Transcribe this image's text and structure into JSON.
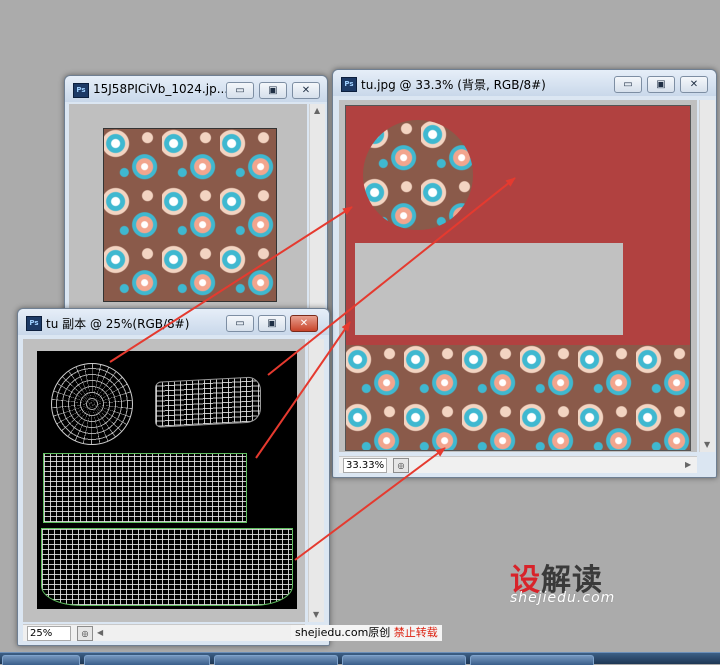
{
  "window_back": {
    "title": "15J58PICiVb_1024.jp...",
    "app_icon": "Ps"
  },
  "window_tu": {
    "title": "tu.jpg @ 33.3% (背景, RGB/8#)",
    "app_icon": "Ps",
    "zoom": "33.33%"
  },
  "window_copy": {
    "title": "tu 副本 @ 25%(RGB/8#)",
    "app_icon": "Ps",
    "zoom": "25%"
  },
  "controls": {
    "minimize_glyph": "▭",
    "maximize_glyph": "▣",
    "close_glyph": "✕",
    "nav_glyph": "◎",
    "arrow_left": "◀",
    "arrow_right": "▶",
    "arrow_up": "▲",
    "arrow_down": "▼"
  },
  "watermark": {
    "logo_part1": "设",
    "logo_part2": "解读",
    "url": "shejiedu.com",
    "footer_site": "shejiedu.com原创",
    "footer_notice": "禁止转载"
  },
  "colors": {
    "canvas_red": "#b14140",
    "arrow_red": "#e53a2f",
    "wire_bg": "#000000"
  }
}
